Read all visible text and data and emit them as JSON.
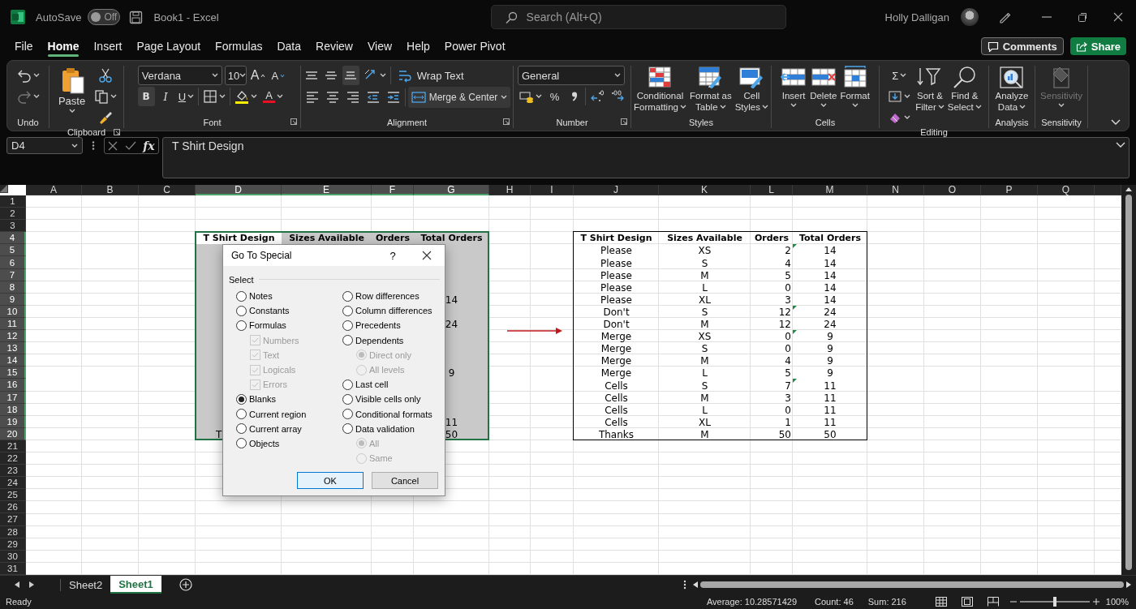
{
  "title_bar": {
    "autosave_label": "AutoSave",
    "autosave": {
      "on": false,
      "text": "Off"
    },
    "document_title": "Book1 - Excel",
    "search_placeholder": "Search (Alt+Q)",
    "user_name": "Holly Dalligan"
  },
  "menu_tabs": [
    {
      "label": "File",
      "selected": false
    },
    {
      "label": "Home",
      "selected": true
    },
    {
      "label": "Insert",
      "selected": false
    },
    {
      "label": "Page Layout",
      "selected": false
    },
    {
      "label": "Formulas",
      "selected": false
    },
    {
      "label": "Data",
      "selected": false
    },
    {
      "label": "Review",
      "selected": false
    },
    {
      "label": "View",
      "selected": false
    },
    {
      "label": "Help",
      "selected": false
    },
    {
      "label": "Power Pivot",
      "selected": false
    }
  ],
  "header_buttons": [
    {
      "kind": "comments",
      "label": "Comments"
    },
    {
      "kind": "share",
      "label": "Share"
    }
  ],
  "ribbon": {
    "groups": [
      {
        "kind": "undo",
        "label": "Undo"
      },
      {
        "kind": "clipboard",
        "label": "Clipboard",
        "paste": "Paste"
      },
      {
        "kind": "font",
        "label": "Font",
        "font_name": "Verdana",
        "font_size": "10",
        "grow": "A",
        "shrink": "A",
        "bold": "B",
        "italic": "I",
        "underline": "U",
        "font_color": "A"
      },
      {
        "kind": "alignment",
        "label": "Alignment",
        "wrap_text": "Wrap Text",
        "merge": "Merge & Center"
      },
      {
        "kind": "number",
        "label": "Number",
        "format": "General",
        "percent": "%"
      },
      {
        "kind": "large",
        "label": "Styles",
        "buttons": [
          {
            "kind": "conditional",
            "lines": [
              "Conditional",
              "Formatting"
            ],
            "disabled": false
          },
          {
            "kind": "table",
            "lines": [
              "Format as",
              "Table"
            ],
            "disabled": false
          },
          {
            "kind": "styles",
            "lines": [
              "Cell",
              "Styles"
            ],
            "disabled": false
          }
        ]
      },
      {
        "kind": "large",
        "label": "Cells",
        "buttons": [
          {
            "kind": "insert",
            "lines": [
              "Insert"
            ],
            "disabled": false
          },
          {
            "kind": "delete",
            "lines": [
              "Delete"
            ],
            "disabled": false
          },
          {
            "kind": "format",
            "lines": [
              "Format"
            ],
            "disabled": false
          }
        ]
      },
      {
        "kind": "editing",
        "label": "Editing",
        "autosum": "Σ",
        "buttons": [
          {
            "kind": "sort",
            "lines": [
              "Sort &",
              "Filter"
            ],
            "disabled": false
          },
          {
            "kind": "find",
            "lines": [
              "Find &",
              "Select"
            ],
            "disabled": false
          }
        ]
      },
      {
        "kind": "large",
        "label": "Analysis",
        "buttons": [
          {
            "kind": "analyze",
            "lines": [
              "Analyze",
              "Data"
            ],
            "disabled": false
          }
        ]
      },
      {
        "kind": "large",
        "label": "Sensitivity",
        "buttons": [
          {
            "kind": "sensitivity",
            "lines": [
              "Sensitivity"
            ],
            "disabled": true
          }
        ]
      }
    ]
  },
  "formula_bar": {
    "name_box": "D4",
    "function_label": "fx",
    "content": "T Shirt Design"
  },
  "sheet": {
    "columns": [
      {
        "label": "A",
        "selected": false
      },
      {
        "label": "B",
        "selected": false
      },
      {
        "label": "C",
        "selected": false
      },
      {
        "label": "D",
        "selected": true
      },
      {
        "label": "E",
        "selected": true
      },
      {
        "label": "F",
        "selected": true
      },
      {
        "label": "G",
        "selected": true
      },
      {
        "label": "H",
        "selected": false
      },
      {
        "label": "I",
        "selected": false
      },
      {
        "label": "J",
        "selected": false
      },
      {
        "label": "K",
        "selected": false
      },
      {
        "label": "L",
        "selected": false
      },
      {
        "label": "M",
        "selected": false
      },
      {
        "label": "N",
        "selected": false
      },
      {
        "label": "O",
        "selected": false
      },
      {
        "label": "P",
        "selected": false
      },
      {
        "label": "Q",
        "selected": false
      }
    ],
    "rows": [
      {
        "label": "1",
        "selected": false
      },
      {
        "label": "2",
        "selected": false
      },
      {
        "label": "3",
        "selected": false
      },
      {
        "label": "4",
        "selected": true
      },
      {
        "label": "5",
        "selected": true
      },
      {
        "label": "6",
        "selected": true
      },
      {
        "label": "7",
        "selected": true
      },
      {
        "label": "8",
        "selected": true
      },
      {
        "label": "9",
        "selected": true
      },
      {
        "label": "10",
        "selected": true
      },
      {
        "label": "11",
        "selected": true
      },
      {
        "label": "12",
        "selected": true
      },
      {
        "label": "13",
        "selected": true
      },
      {
        "label": "14",
        "selected": true
      },
      {
        "label": "15",
        "selected": true
      },
      {
        "label": "16",
        "selected": true
      },
      {
        "label": "17",
        "selected": true
      },
      {
        "label": "18",
        "selected": true
      },
      {
        "label": "19",
        "selected": true
      },
      {
        "label": "20",
        "selected": true
      },
      {
        "label": "21",
        "selected": false
      },
      {
        "label": "22",
        "selected": false
      },
      {
        "label": "23",
        "selected": false
      },
      {
        "label": "24",
        "selected": false
      },
      {
        "label": "25",
        "selected": false
      },
      {
        "label": "26",
        "selected": false
      },
      {
        "label": "27",
        "selected": false
      },
      {
        "label": "28",
        "selected": false
      },
      {
        "label": "29",
        "selected": false
      },
      {
        "label": "30",
        "selected": false
      },
      {
        "label": "31",
        "selected": false
      }
    ]
  },
  "source_table": {
    "headers": [
      "T Shirt Design",
      "Sizes Available",
      "Orders",
      "Total Orders"
    ],
    "cut_cell": "T",
    "totals": [
      "14",
      "24",
      "9",
      "11",
      "50"
    ]
  },
  "result_table": {
    "headers": [
      "T Shirt Design",
      "Sizes Available",
      "Orders",
      "Total Orders"
    ],
    "rows": [
      {
        "design": "Please",
        "size": "XS",
        "orders": "2",
        "total": "14",
        "error_mark": true
      },
      {
        "design": "Please",
        "size": "S",
        "orders": "4",
        "total": "14",
        "error_mark": false
      },
      {
        "design": "Please",
        "size": "M",
        "orders": "5",
        "total": "14",
        "error_mark": false
      },
      {
        "design": "Please",
        "size": "L",
        "orders": "0",
        "total": "14",
        "error_mark": false
      },
      {
        "design": "Please",
        "size": "XL",
        "orders": "3",
        "total": "14",
        "error_mark": false
      },
      {
        "design": "Don't",
        "size": "S",
        "orders": "12",
        "total": "24",
        "error_mark": true
      },
      {
        "design": "Don't",
        "size": "M",
        "orders": "12",
        "total": "24",
        "error_mark": false
      },
      {
        "design": "Merge",
        "size": "XS",
        "orders": "0",
        "total": "9",
        "error_mark": true
      },
      {
        "design": "Merge",
        "size": "S",
        "orders": "0",
        "total": "9",
        "error_mark": false
      },
      {
        "design": "Merge",
        "size": "M",
        "orders": "4",
        "total": "9",
        "error_mark": false
      },
      {
        "design": "Merge",
        "size": "L",
        "orders": "5",
        "total": "9",
        "error_mark": false
      },
      {
        "design": "Cells",
        "size": "S",
        "orders": "7",
        "total": "11",
        "error_mark": true
      },
      {
        "design": "Cells",
        "size": "M",
        "orders": "3",
        "total": "11",
        "error_mark": false
      },
      {
        "design": "Cells",
        "size": "L",
        "orders": "0",
        "total": "11",
        "error_mark": false
      },
      {
        "design": "Cells",
        "size": "XL",
        "orders": "1",
        "total": "11",
        "error_mark": false
      },
      {
        "design": "Thanks",
        "size": "M",
        "orders": "50",
        "total": "50",
        "error_mark": false
      }
    ]
  },
  "dialog": {
    "title": "Go To Special",
    "help": "?",
    "group_label": "Select",
    "left_options": [
      {
        "kind": "radio",
        "label": "Notes",
        "selected": false,
        "disabled": false
      },
      {
        "kind": "radio",
        "label": "Constants",
        "selected": false,
        "disabled": false
      },
      {
        "kind": "radio",
        "label": "Formulas",
        "selected": false,
        "disabled": false,
        "children": [
          {
            "kind": "checkbox",
            "label": "Numbers",
            "checked": true,
            "disabled": true
          },
          {
            "kind": "checkbox",
            "label": "Text",
            "checked": true,
            "disabled": true
          },
          {
            "kind": "checkbox",
            "label": "Logicals",
            "checked": true,
            "disabled": true
          },
          {
            "kind": "checkbox",
            "label": "Errors",
            "checked": true,
            "disabled": true
          }
        ]
      },
      {
        "kind": "radio",
        "label": "Blanks",
        "selected": true,
        "disabled": false
      },
      {
        "kind": "radio",
        "label": "Current region",
        "selected": false,
        "disabled": false
      },
      {
        "kind": "radio",
        "label": "Current array",
        "selected": false,
        "disabled": false
      },
      {
        "kind": "radio",
        "label": "Objects",
        "selected": false,
        "disabled": false
      }
    ],
    "right_options": [
      {
        "kind": "radio",
        "label": "Row differences",
        "selected": false,
        "disabled": false
      },
      {
        "kind": "radio",
        "label": "Column differences",
        "selected": false,
        "disabled": false
      },
      {
        "kind": "radio",
        "label": "Precedents",
        "selected": false,
        "disabled": false
      },
      {
        "kind": "radio",
        "label": "Dependents",
        "selected": false,
        "disabled": false,
        "children": [
          {
            "kind": "radio",
            "label": "Direct only",
            "selected": true,
            "disabled": true
          },
          {
            "kind": "radio",
            "label": "All levels",
            "selected": false,
            "disabled": true
          }
        ]
      },
      {
        "kind": "radio",
        "label": "Last cell",
        "selected": false,
        "disabled": false
      },
      {
        "kind": "radio",
        "label": "Visible cells only",
        "selected": false,
        "disabled": false
      },
      {
        "kind": "radio",
        "label": "Conditional formats",
        "selected": false,
        "disabled": false
      },
      {
        "kind": "radio",
        "label": "Data validation",
        "selected": false,
        "disabled": false,
        "children": [
          {
            "kind": "radio",
            "label": "All",
            "selected": true,
            "disabled": true
          },
          {
            "kind": "radio",
            "label": "Same",
            "selected": false,
            "disabled": true
          }
        ]
      }
    ],
    "buttons": [
      {
        "label": "OK",
        "default": true
      },
      {
        "label": "Cancel",
        "default": false
      }
    ]
  },
  "sheet_tabs": [
    {
      "label": "Sheet2",
      "selected": false
    },
    {
      "label": "Sheet1",
      "selected": true
    }
  ],
  "status_bar": {
    "mode": "Ready",
    "average": "Average: 10.28571429",
    "count": "Count: 46",
    "sum": "Sum: 216",
    "zoom": "100%",
    "zoom_slider": {
      "level": 0.5
    }
  }
}
